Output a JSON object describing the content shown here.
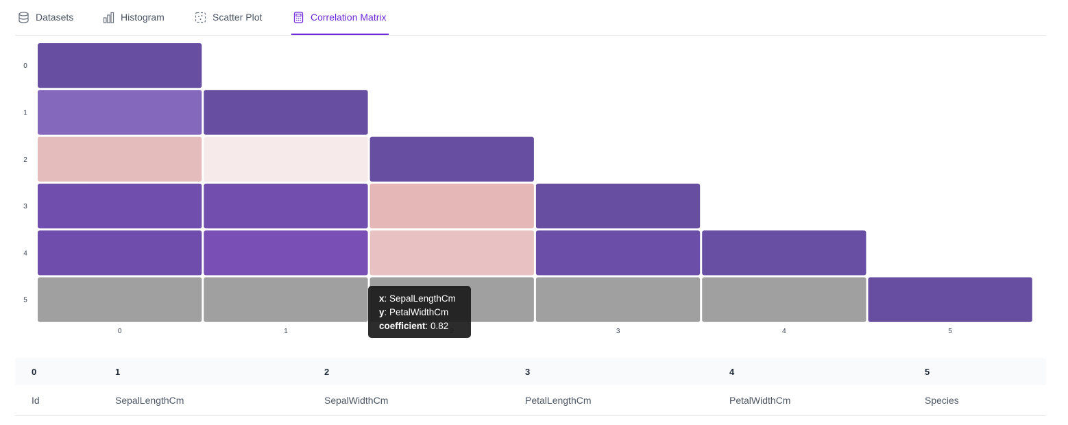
{
  "tabs": [
    {
      "label": "Datasets",
      "icon": "database-icon",
      "active": false
    },
    {
      "label": "Histogram",
      "icon": "histogram-icon",
      "active": false
    },
    {
      "label": "Scatter Plot",
      "icon": "scatter-plot-icon",
      "active": false
    },
    {
      "label": "Correlation Matrix",
      "icon": "calculator-icon",
      "active": true
    }
  ],
  "colors": {
    "accent": "#6d28d9",
    "grey_cell": "#a0a0a0"
  },
  "chart_data": {
    "type": "heatmap",
    "x_ticks": [
      "0",
      "1",
      "2",
      "3",
      "4",
      "5"
    ],
    "y_ticks": [
      "0",
      "1",
      "2",
      "3",
      "4",
      "5"
    ],
    "cells": [
      {
        "x": 0,
        "y": 0,
        "color": "#674ea0"
      },
      {
        "x": 0,
        "y": 1,
        "color": "#8468bb"
      },
      {
        "x": 1,
        "y": 1,
        "color": "#674ea0"
      },
      {
        "x": 0,
        "y": 2,
        "color": "#e4bcbc"
      },
      {
        "x": 1,
        "y": 2,
        "color": "#f7eaea"
      },
      {
        "x": 2,
        "y": 2,
        "color": "#674ea0"
      },
      {
        "x": 0,
        "y": 3,
        "color": "#704ead"
      },
      {
        "x": 1,
        "y": 3,
        "color": "#724faf"
      },
      {
        "x": 2,
        "y": 3,
        "color": "#e5b7b7"
      },
      {
        "x": 3,
        "y": 3,
        "color": "#674ea0"
      },
      {
        "x": 0,
        "y": 4,
        "color": "#6e4dac"
      },
      {
        "x": 1,
        "y": 4,
        "color": "#7a4fb5"
      },
      {
        "x": 2,
        "y": 4,
        "color": "#e8c2c2"
      },
      {
        "x": 3,
        "y": 4,
        "color": "#6a4ea8"
      },
      {
        "x": 4,
        "y": 4,
        "color": "#684fa4"
      },
      {
        "x": 0,
        "y": 5,
        "color": "#a0a0a0"
      },
      {
        "x": 1,
        "y": 5,
        "color": "#a0a0a0"
      },
      {
        "x": 2,
        "y": 5,
        "color": "#a0a0a0"
      },
      {
        "x": 3,
        "y": 5,
        "color": "#a0a0a0"
      },
      {
        "x": 4,
        "y": 5,
        "color": "#a0a0a0"
      },
      {
        "x": 5,
        "y": 5,
        "color": "#674ea0"
      }
    ],
    "tooltip": {
      "x_key": "x",
      "x_value": "SepalLengthCm",
      "y_key": "y",
      "y_value": "PetalWidthCm",
      "coef_key": "coefficient",
      "coef_value": "0.82"
    }
  },
  "legend_table": {
    "headers": [
      "0",
      "1",
      "2",
      "3",
      "4",
      "5"
    ],
    "names": [
      "Id",
      "SepalLengthCm",
      "SepalWidthCm",
      "PetalLengthCm",
      "PetalWidthCm",
      "Species"
    ]
  }
}
